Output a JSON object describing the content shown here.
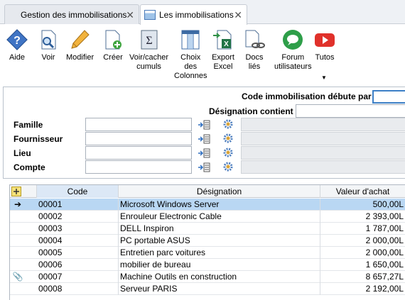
{
  "tabs": [
    {
      "label": "Gestion des immobilisations",
      "close": "✕"
    },
    {
      "label": "Les immobilisations",
      "close": "✕"
    }
  ],
  "toolbar": [
    {
      "label": "Aide",
      "icon": "help-icon"
    },
    {
      "label": "Voir",
      "icon": "view-document-icon"
    },
    {
      "label": "Modifier",
      "icon": "pencil-icon"
    },
    {
      "label": "Créer",
      "icon": "create-document-icon"
    },
    {
      "label": "Voir/cacher\ncumuls",
      "icon": "sigma-icon"
    },
    {
      "label": "Choix\ndes\nColonnes",
      "icon": "columns-icon"
    },
    {
      "label": "Export\nExcel",
      "icon": "excel-export-icon"
    },
    {
      "label": "Docs\nliés",
      "icon": "linked-docs-icon"
    },
    {
      "label": "Forum\nutilisateurs",
      "icon": "forum-icon"
    },
    {
      "label": "Tutos",
      "icon": "video-play-icon"
    }
  ],
  "filters": {
    "code_label": "Code immobilisation débute par",
    "code_value": "",
    "designation_label": "Désignation contient",
    "designation_value": "",
    "rows": [
      {
        "label": "Famille",
        "value": ""
      },
      {
        "label": "Fournisseur",
        "value": ""
      },
      {
        "label": "Lieu",
        "value": ""
      },
      {
        "label": "Compte",
        "value": ""
      }
    ]
  },
  "grid": {
    "columns": [
      "Code",
      "Désignation",
      "Valeur d'achat"
    ],
    "rows": [
      {
        "code": "00001",
        "designation": "Microsoft Windows Server",
        "valeur": "500,00L",
        "marker": "➔",
        "selected": true
      },
      {
        "code": "00002",
        "designation": "Enrouleur Electronic Cable",
        "valeur": "2 393,00L",
        "marker": ""
      },
      {
        "code": "00003",
        "designation": "DELL Inspiron",
        "valeur": "1 787,00L",
        "marker": ""
      },
      {
        "code": "00004",
        "designation": "PC portable ASUS",
        "valeur": "2 000,00L",
        "marker": ""
      },
      {
        "code": "00005",
        "designation": "Entretien parc voitures",
        "valeur": "2 000,00L",
        "marker": ""
      },
      {
        "code": "00006",
        "designation": "mobilier de bureau",
        "valeur": "1 650,00L",
        "marker": ""
      },
      {
        "code": "00007",
        "designation": "Machine Outils en construction",
        "valeur": "8 657,27L",
        "marker": "📎"
      },
      {
        "code": "00008",
        "designation": "Serveur PARIS",
        "valeur": "2 192,00L",
        "marker": ""
      }
    ]
  }
}
